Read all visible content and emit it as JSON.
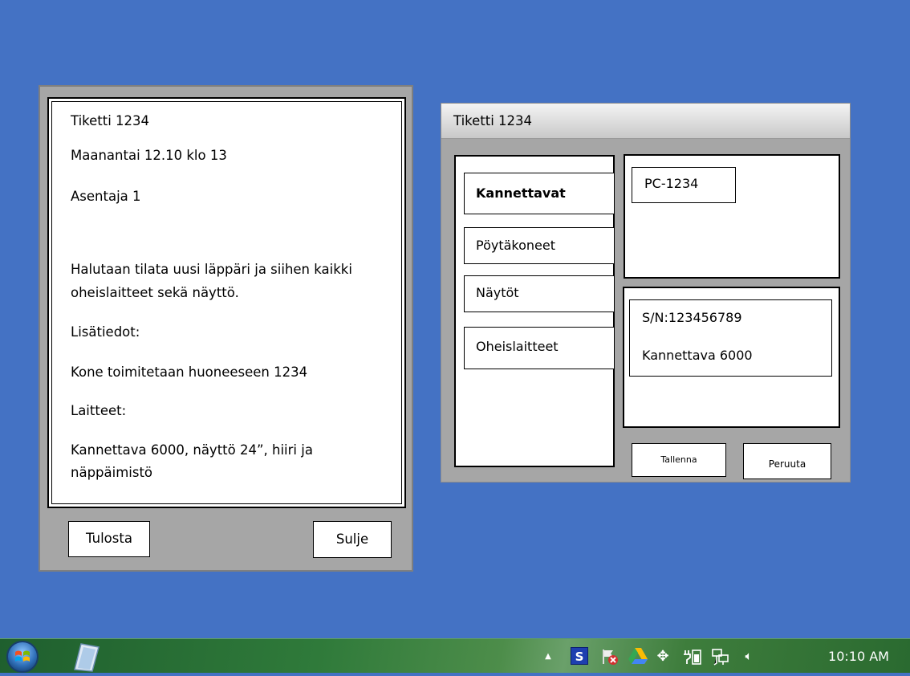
{
  "ticket_window": {
    "lines": {
      "title": "Tiketti 1234",
      "date": "Maanantai 12.10 klo 13",
      "assignee": "Asentaja 1",
      "description_1": "Halutaan tilata uusi läppäri ja siihen kaikki",
      "description_2": "oheislaitteet sekä näyttö.",
      "extra_label": "Lisätiedot:",
      "extra_text": "Kone toimitetaan huoneeseen 1234",
      "devices_label": "Laitteet:",
      "devices_1": "Kannettava 6000, näyttö 24”, hiiri ja",
      "devices_2": "näppäimistö"
    },
    "print_button": "Tulosta",
    "close_button": "Sulje"
  },
  "device_window": {
    "title": "Tiketti 1234",
    "categories": {
      "laptops": "Kannettavat",
      "desktops": "Pöytäkoneet",
      "displays": "Näytöt",
      "peripherals": "Oheislaitteet"
    },
    "selected_category": "Kannettavat",
    "device_id": "PC-1234",
    "serial": "S/N:123456789",
    "model": "Kannettava 6000",
    "save_button": "Tallenna",
    "cancel_button": "Peruuta"
  },
  "taskbar": {
    "clock": "10:10 AM",
    "tray_icons": [
      "show-hidden-arrow-icon",
      "s-app-icon",
      "action-center-flag-icon",
      "drive-icon",
      "move-icon",
      "power-icon",
      "network-icon",
      "volume-icon"
    ],
    "pinned": [
      "start-orb-icon",
      "notepad-icon"
    ]
  }
}
